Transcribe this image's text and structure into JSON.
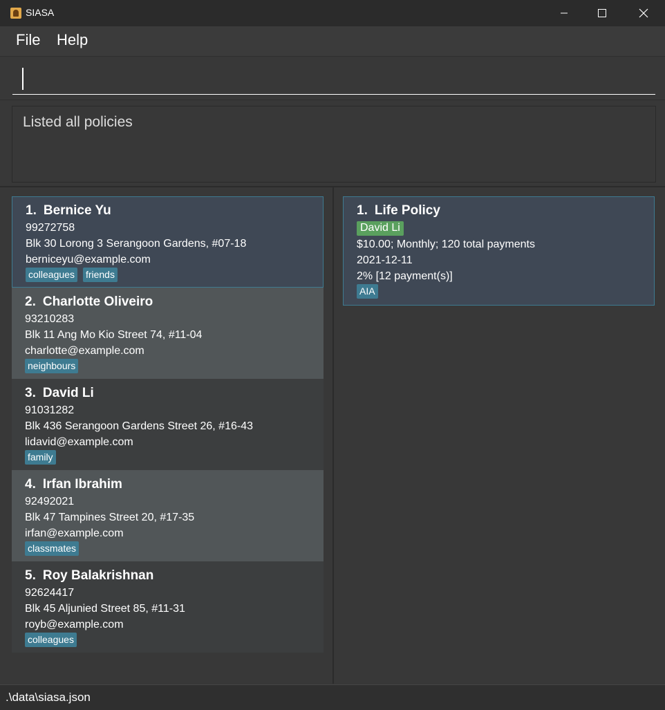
{
  "window": {
    "title": "SIASA",
    "icon": "contact-book-icon",
    "controls": [
      "minimize-icon",
      "maximize-icon",
      "close-icon"
    ]
  },
  "menu": {
    "file": "File",
    "help": "Help"
  },
  "command": {
    "value": "",
    "placeholder": ""
  },
  "result": {
    "message": "Listed all policies"
  },
  "persons": [
    {
      "index": "1.",
      "name": "Bernice Yu",
      "phone": "99272758",
      "address": "Blk 30 Lorong 3 Serangoon Gardens, #07-18",
      "email": "berniceyu@example.com",
      "tags": [
        "colleagues",
        "friends"
      ]
    },
    {
      "index": "2.",
      "name": "Charlotte Oliveiro",
      "phone": "93210283",
      "address": "Blk 11 Ang Mo Kio Street 74, #11-04",
      "email": "charlotte@example.com",
      "tags": [
        "neighbours"
      ]
    },
    {
      "index": "3.",
      "name": "David Li",
      "phone": "91031282",
      "address": "Blk 436 Serangoon Gardens Street 26, #16-43",
      "email": "lidavid@example.com",
      "tags": [
        "family"
      ]
    },
    {
      "index": "4.",
      "name": "Irfan Ibrahim",
      "phone": "92492021",
      "address": "Blk 47 Tampines Street 20, #17-35",
      "email": "irfan@example.com",
      "tags": [
        "classmates"
      ]
    },
    {
      "index": "5.",
      "name": "Roy Balakrishnan",
      "phone": "92624417",
      "address": "Blk 45 Aljunied Street 85, #11-31",
      "email": "royb@example.com",
      "tags": [
        "colleagues"
      ]
    }
  ],
  "policies": [
    {
      "index": "1.",
      "name": "Life Policy",
      "owner": "David Li",
      "payment": "$10.00; Monthly; 120 total payments",
      "expiry": "2021-12-11",
      "commission": "2% [12 payment(s)]",
      "tags": [
        "AIA"
      ]
    }
  ],
  "status": {
    "path": ".\\data\\siasa.json"
  },
  "colors": {
    "tag": "#3e7b91",
    "owner_tag": "#5aa05e",
    "selected_card": "#3f4855",
    "background": "#383838"
  }
}
